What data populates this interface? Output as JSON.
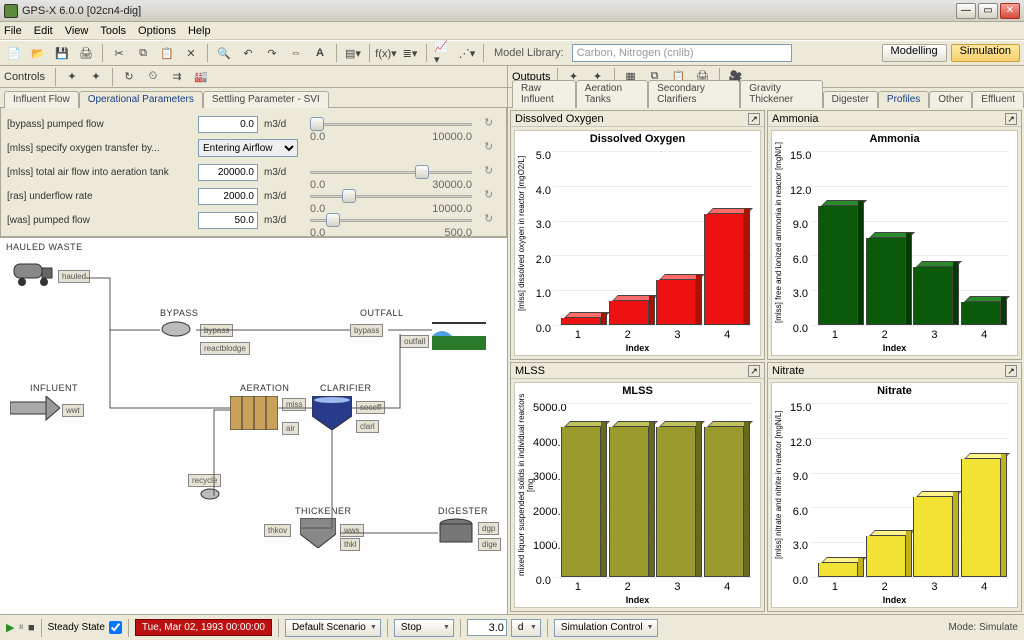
{
  "window": {
    "title": "GPS-X 6.0.0 [02cn4-dig]"
  },
  "menus": [
    "File",
    "Edit",
    "View",
    "Tools",
    "Options",
    "Help"
  ],
  "model_library_label": "Model Library:",
  "model_library_value": "Carbon, Nitrogen (cnlib)",
  "mode_buttons": {
    "modelling": "Modelling",
    "simulation": "Simulation"
  },
  "controls_label": "Controls",
  "outputs_label": "Outputs",
  "left_tabs": [
    "Influent Flow",
    "Operational Parameters",
    "Settling Parameter - SVI"
  ],
  "params": [
    {
      "label": "[bypass] pumped flow",
      "value": "0.0",
      "unit": "m3/d",
      "min": "0.0",
      "max": "10000.0",
      "thumb": 0.0
    },
    {
      "label": "[mlss] specify oxygen transfer by...",
      "select": "Entering Airflow"
    },
    {
      "label": "[mlss] total air flow into aeration tank",
      "value": "20000.0",
      "unit": "m3/d",
      "min": "0.0",
      "max": "30000.0",
      "thumb": 0.67
    },
    {
      "label": "[ras] underflow rate",
      "value": "2000.0",
      "unit": "m3/d",
      "min": "0.0",
      "max": "10000.0",
      "thumb": 0.2
    },
    {
      "label": "[was] pumped flow",
      "value": "50.0",
      "unit": "m3/d",
      "min": "0.0",
      "max": "500.0",
      "thumb": 0.1
    }
  ],
  "pfd": {
    "title": "HAULED WASTE",
    "labels": {
      "bypass": "BYPASS",
      "outfall": "OUTFALL",
      "influent": "INFLUENT",
      "aeration": "AERATION",
      "clarifier": "CLARIFIER",
      "thickener": "THICKENER",
      "digester": "DIGESTER"
    }
  },
  "out_tabs": [
    "Raw Influent",
    "Aeration Tanks",
    "Secondary Clarifiers",
    "Gravity Thickener",
    "Digester",
    "Profiles",
    "Other",
    "Effluent"
  ],
  "charts": {
    "do": {
      "head": "Dissolved Oxygen",
      "title": "Dissolved Oxygen",
      "ylabel": "[mlss] dissolved oxygen in reactor [mgO2/L]",
      "xlabel": "Index"
    },
    "nh": {
      "head": "Ammonia",
      "title": "Ammonia",
      "ylabel": "[mlss] free and ionized ammonia in reactor [mgN/L]",
      "xlabel": "Index"
    },
    "mlss": {
      "head": "MLSS",
      "title": "MLSS",
      "ylabel": "mixed liquor suspended solids in individual reactors [mg",
      "xlabel": "Index"
    },
    "no3": {
      "head": "Nitrate",
      "title": "Nitrate",
      "ylabel": "[mlss] nitrate and nitrite in reactor [mgN/L]",
      "xlabel": "Index"
    }
  },
  "chart_data": [
    {
      "id": "do",
      "type": "bar",
      "title": "Dissolved Oxygen",
      "categories": [
        "1",
        "2",
        "3",
        "4"
      ],
      "values": [
        0.2,
        0.7,
        1.3,
        3.2
      ],
      "ylim": [
        0,
        5
      ],
      "yticks": [
        "5.0",
        "4.0",
        "3.0",
        "2.0",
        "1.0",
        "0.0"
      ],
      "xlabel": "Index",
      "ylabel": "[mlss] dissolved oxygen in reactor [mgO2/L]",
      "color": "#e11"
    },
    {
      "id": "nh",
      "type": "bar",
      "title": "Ammonia",
      "categories": [
        "1",
        "2",
        "3",
        "4"
      ],
      "values": [
        10.3,
        7.5,
        5.0,
        2.0
      ],
      "ylim": [
        0,
        15
      ],
      "yticks": [
        "15.0",
        "12.0",
        "9.0",
        "6.0",
        "3.0",
        "0.0"
      ],
      "xlabel": "Index",
      "ylabel": "[mlss] free and ionized ammonia in reactor [mgN/L]",
      "color": "#0a5a0a"
    },
    {
      "id": "mlss",
      "type": "bar",
      "title": "MLSS",
      "categories": [
        "1",
        "2",
        "3",
        "4"
      ],
      "values": [
        4300,
        4300,
        4300,
        4300
      ],
      "ylim": [
        0,
        5000
      ],
      "yticks": [
        "5000.0",
        "4000.0",
        "3000.0",
        "2000.0",
        "1000.0",
        "0.0"
      ],
      "xlabel": "Index",
      "ylabel": "mixed liquor suspended solids in individual reactors [mg",
      "color": "#9a9a2d"
    },
    {
      "id": "no3",
      "type": "bar",
      "title": "Nitrate",
      "categories": [
        "1",
        "2",
        "3",
        "4"
      ],
      "values": [
        1.2,
        3.5,
        6.9,
        10.2
      ],
      "ylim": [
        0,
        15
      ],
      "yticks": [
        "15.0",
        "12.0",
        "9.0",
        "6.0",
        "3.0",
        "0.0"
      ],
      "xlabel": "Index",
      "ylabel": "[mlss] nitrate and nitrite in reactor [mgN/L]",
      "color": "#f2e233"
    }
  ],
  "bottom": {
    "steady": "Steady State",
    "date": "Tue, Mar 02, 1993  00:00:00",
    "scenario": "Default Scenario",
    "stop": "Stop",
    "dur": "3.0",
    "unit": "d",
    "simctrl": "Simulation Control",
    "mode": "Mode: Simulate"
  }
}
